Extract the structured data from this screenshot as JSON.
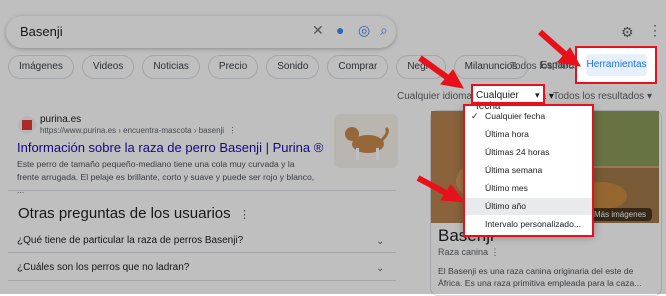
{
  "search": {
    "query": "Basenji"
  },
  "chips": [
    "Imágenes",
    "Videos",
    "Noticias",
    "Precio",
    "Sonido",
    "Comprar",
    "Negro",
    "Milanuncios",
    "España"
  ],
  "toolbar": {
    "all_filters": "Todos los filtros",
    "tools": "Herramientas"
  },
  "subfilters": {
    "language": "Cualquier idioma",
    "date": "Cualquier fecha",
    "results": "Todos los resultados"
  },
  "result": {
    "site": "purina.es",
    "url": "https://www.purina.es › encuentra-mascota › basenji",
    "title": "Información sobre la raza de perro Basenji | Purina ®",
    "snippet": "Este perro de tamaño pequeño-mediano tiene una cola muy curvada y la frente arrugada. El pelaje es brillante, corto y suave y puede ser rojo y blanco, ..."
  },
  "people_also_ask": {
    "heading": "Otras preguntas de los usuarios",
    "questions": [
      "¿Qué tiene de particular la raza de perros Basenji?",
      "¿Cuáles son los perros que no ladran?"
    ]
  },
  "knowledge_panel": {
    "more_images": "Más imágenes",
    "title": "Basenji",
    "subtitle": "Raza canina",
    "text": "El Basenji es una raza canina originaria del este de África. Es una raza primitiva empleada para la caza..."
  },
  "date_menu": {
    "items": [
      "Cualquier fecha",
      "Última hora",
      "Últimas 24 horas",
      "Última semana",
      "Último mes",
      "Último año",
      "Intervalo personalizado..."
    ],
    "selected": "Cualquier fecha",
    "highlighted": "Último año"
  },
  "colors": {
    "annotation_red": "#e8101a",
    "link_blue": "#1a0dab",
    "accent_blue": "#1a73e8"
  }
}
